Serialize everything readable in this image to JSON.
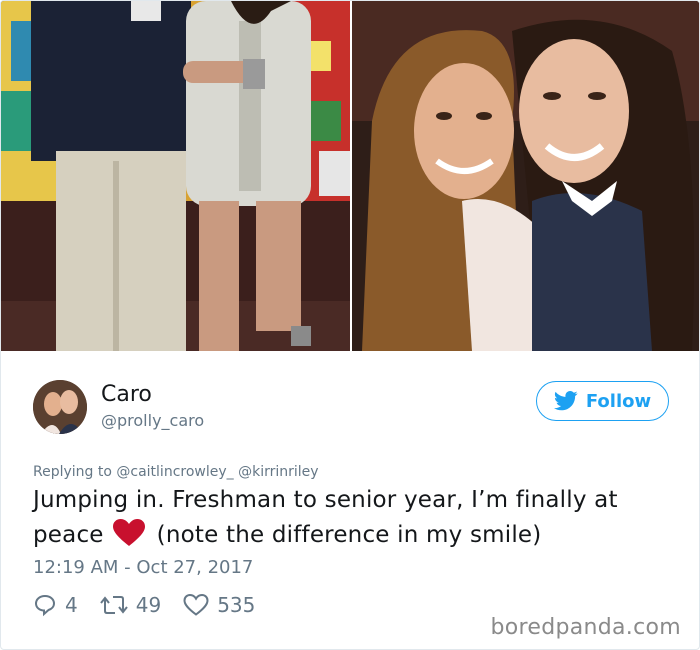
{
  "tweet": {
    "author_name": "Caro",
    "author_handle": "@prolly_caro",
    "follow_label": "Follow",
    "replying_prefix": "Replying to",
    "replying_to": [
      "@caitlincrowley_",
      "@kirrinriley"
    ],
    "text_part1": "Jumping in. Freshman to senior year, I’m finally at",
    "text_part2": "peace",
    "text_part3": "(note the difference in my smile)",
    "timestamp": "12:19 AM - Oct 27, 2017",
    "replies": "4",
    "retweets": "49",
    "likes": "535"
  },
  "watermark": "boredpanda.com",
  "colors": {
    "accent": "#1da1f2",
    "muted": "#657786",
    "heart": "#e0245e"
  }
}
